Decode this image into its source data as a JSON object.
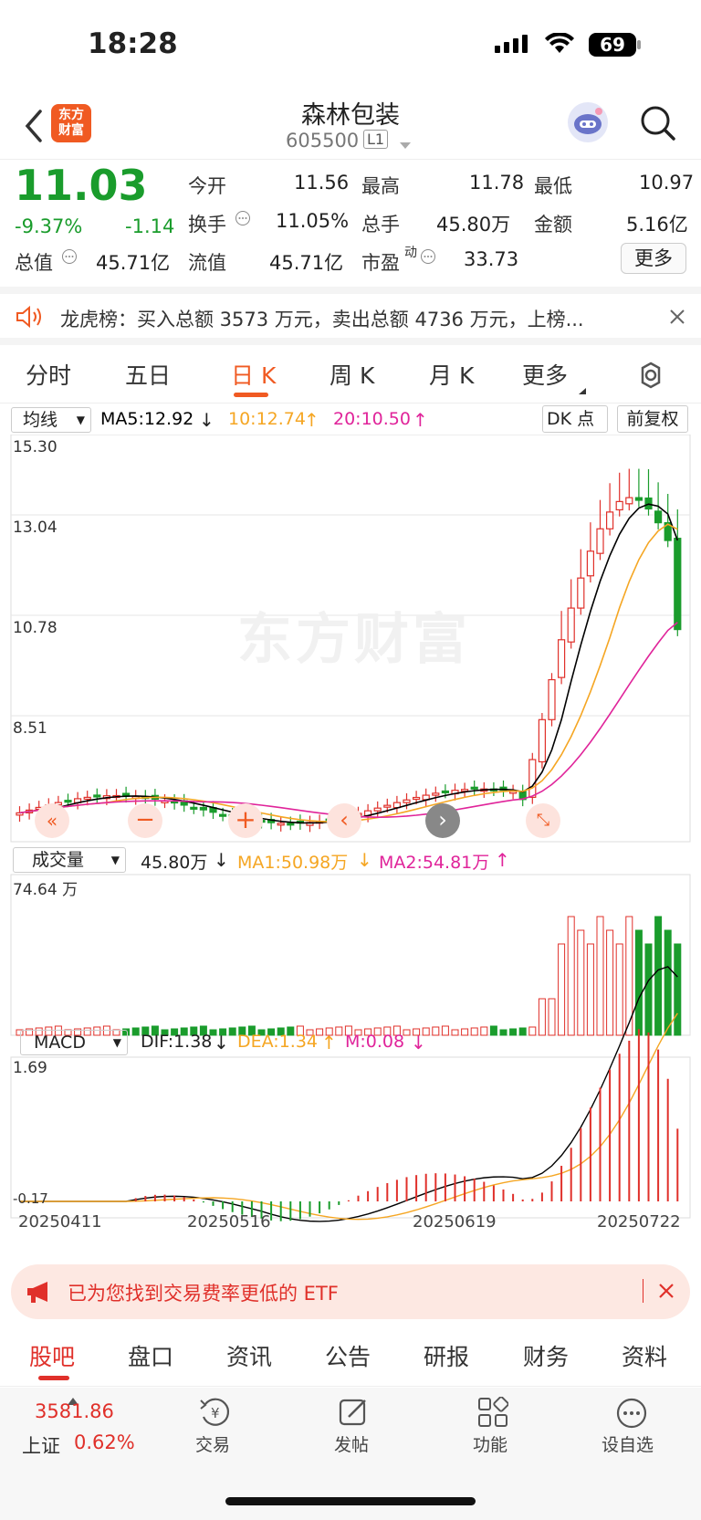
{
  "status": {
    "time": "18:28",
    "battery": "69"
  },
  "nav": {
    "title": "森林包装",
    "code": "605500",
    "level": "L1",
    "logo_line1": "东方",
    "logo_line2": "财富"
  },
  "quote": {
    "price": "11.03",
    "pct": "-9.37%",
    "chg": "-1.14",
    "open_label": "今开",
    "open": "11.56",
    "high_label": "最高",
    "high": "11.78",
    "low_label": "最低",
    "low": "10.97",
    "turnover_label": "换手",
    "turnover": "11.05%",
    "volume_label": "总手",
    "volume": "45.80万",
    "amount_label": "金额",
    "amount": "5.16亿",
    "mktcap_label": "总值",
    "mktcap": "45.71亿",
    "float_label": "流值",
    "float": "45.71亿",
    "pe_label": "市盈",
    "pe_sup": "动",
    "pe": "33.73",
    "more": "更多"
  },
  "notice": {
    "text": "龙虎榜：买入总额 3573 万元，卖出总额 4736 万元，上榜..."
  },
  "tabs": [
    "分时",
    "五日",
    "日 K",
    "周 K",
    "月 K",
    "更多"
  ],
  "active_tab": "日 K",
  "ma_bar": {
    "selector": "均线",
    "ma5": "MA5:12.92",
    "ma10": "10:12.74",
    "ma20": "20:10.50",
    "dk": "DK 点",
    "adjust": "前复权"
  },
  "price_axis": [
    "15.30",
    "13.04",
    "10.78",
    "8.51"
  ],
  "watermark": "东方财富",
  "vol_bar": {
    "selector": "成交量",
    "vol": "45.80万",
    "ma1": "MA1:50.98万",
    "ma2": "MA2:54.81万",
    "axis": "74.64 万"
  },
  "macd_bar": {
    "selector": "MACD",
    "dif": "DIF:1.38",
    "dea": "DEA:1.34",
    "m": "M:0.08",
    "axis_top": "1.69",
    "axis_bottom": "-0.17"
  },
  "dates": [
    "20250411",
    "20250516",
    "20250619",
    "20250722"
  ],
  "etf": {
    "text": "已为您找到交易费率更低的 ETF"
  },
  "bottom_tabs": [
    "股吧",
    "盘口",
    "资讯",
    "公告",
    "研报",
    "财务",
    "资料"
  ],
  "bottombar": {
    "index_value": "3581.86",
    "index_name": "上证",
    "index_pct": "0.62%",
    "trade": "交易",
    "post": "发帖",
    "func": "功能",
    "fav": "设自选"
  },
  "colors": {
    "up": "#e0302a",
    "down": "#1a9c2c",
    "ma5": "#000000",
    "ma10": "#f5a623",
    "ma20": "#e0249a",
    "accent": "#f05a22"
  },
  "chart_data": {
    "type": "candlestick",
    "note_series": "daily K line with MA5/MA10/MA20, volume and MACD",
    "ylim": [
      6.25,
      15.3
    ],
    "last": {
      "open": 11.56,
      "high": 11.78,
      "low": 10.97,
      "close": 11.03
    }
  }
}
